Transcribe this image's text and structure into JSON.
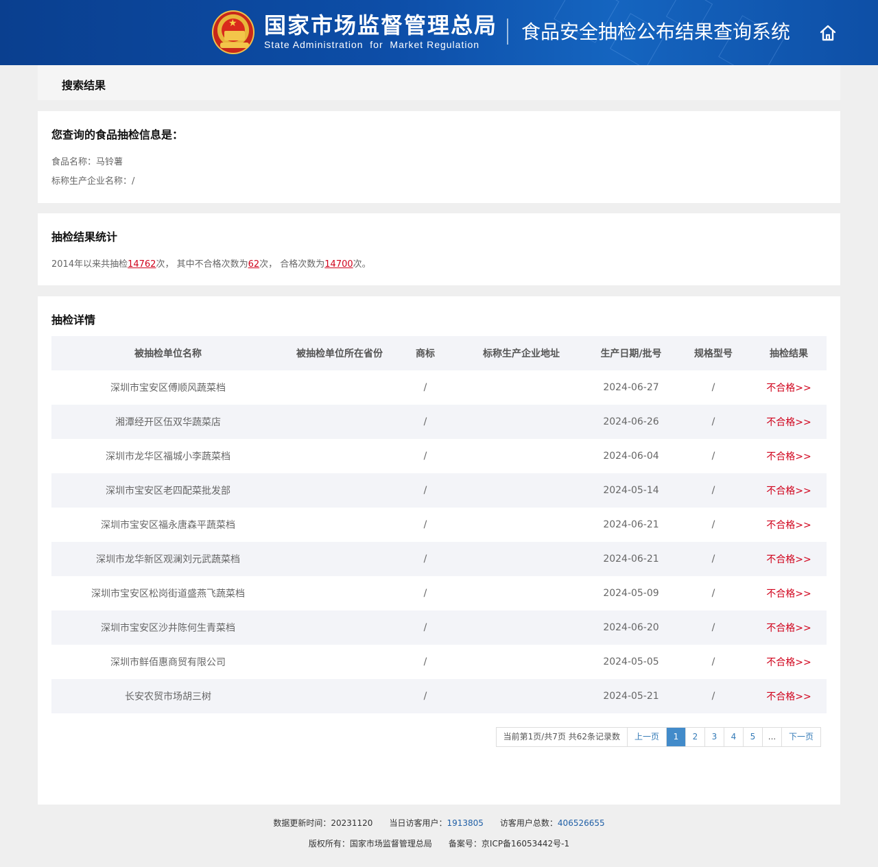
{
  "header": {
    "org_cn": "国家市场监督管理总局",
    "org_en": "State Administration  for  Market Regulation",
    "system_title": "食品安全抽检公布结果查询系统"
  },
  "breadcrumb": "搜索结果",
  "info": {
    "title": "您查询的食品抽检信息是：",
    "food_name": "食品名称：马铃薯",
    "manufacturer": "标称生产企业名称：/"
  },
  "stats": {
    "title": "抽检结果统计",
    "prefix": "2014年以来共抽检",
    "total": "14762",
    "mid1": "次， 其中不合格次数为",
    "fail": "62",
    "mid2": "次， 合格次数为",
    "pass": "14700",
    "suffix": "次。"
  },
  "detail": {
    "title": "抽检详情",
    "columns": [
      "被抽检单位名称",
      "被抽检单位所在省份",
      "商标",
      "标称生产企业地址",
      "生产日期/批号",
      "规格型号",
      "抽检结果"
    ],
    "rows": [
      {
        "unit": "深圳市宝安区傅顺风蔬菜档",
        "province": "",
        "brand": "/",
        "address": "",
        "date": "2024-06-27",
        "spec": "/",
        "result": "不合格>>"
      },
      {
        "unit": "湘潭经开区伍双华蔬菜店",
        "province": "",
        "brand": "/",
        "address": "",
        "date": "2024-06-26",
        "spec": "/",
        "result": "不合格>>"
      },
      {
        "unit": "深圳市龙华区福城小李蔬菜档",
        "province": "",
        "brand": "/",
        "address": "",
        "date": "2024-06-04",
        "spec": "/",
        "result": "不合格>>"
      },
      {
        "unit": "深圳市宝安区老四配菜批发部",
        "province": "",
        "brand": "/",
        "address": "",
        "date": "2024-05-14",
        "spec": "/",
        "result": "不合格>>"
      },
      {
        "unit": "深圳市宝安区福永唐森平蔬菜档",
        "province": "",
        "brand": "/",
        "address": "",
        "date": "2024-06-21",
        "spec": "/",
        "result": "不合格>>"
      },
      {
        "unit": "深圳市龙华新区观澜刘元武蔬菜档",
        "province": "",
        "brand": "/",
        "address": "",
        "date": "2024-06-21",
        "spec": "/",
        "result": "不合格>>"
      },
      {
        "unit": "深圳市宝安区松岗街道盛燕飞蔬菜档",
        "province": "",
        "brand": "/",
        "address": "",
        "date": "2024-05-09",
        "spec": "/",
        "result": "不合格>>"
      },
      {
        "unit": "深圳市宝安区沙井陈何生青菜档",
        "province": "",
        "brand": "/",
        "address": "",
        "date": "2024-06-20",
        "spec": "/",
        "result": "不合格>>"
      },
      {
        "unit": "深圳市鲜佰惠商贸有限公司",
        "province": "",
        "brand": "/",
        "address": "",
        "date": "2024-05-05",
        "spec": "/",
        "result": "不合格>>"
      },
      {
        "unit": "长安农贸市场胡三树",
        "province": "",
        "brand": "/",
        "address": "",
        "date": "2024-05-21",
        "spec": "/",
        "result": "不合格>>"
      }
    ]
  },
  "pagination": {
    "info": "当前第1页/共7页 共62条记录数",
    "prev": "上一页",
    "pages": [
      "1",
      "2",
      "3",
      "4",
      "5"
    ],
    "current": "1",
    "ellipsis": "...",
    "next": "下一页"
  },
  "footer": {
    "update_label": "数据更新时间：",
    "update_value": "20231120",
    "today_label": "当日访客用户：",
    "today_value": "1913805",
    "total_label": "访客用户总数：",
    "total_value": "406526655",
    "copyright": "版权所有：国家市场监督管理总局",
    "icp": "备案号：京ICP备16053442号-1"
  },
  "colors": {
    "header_blue": "#0d4ea8",
    "fail_red": "#d0021b",
    "link_blue": "#337ab7",
    "active_page": "#428bca"
  },
  "icons": [
    "national-emblem-icon",
    "home-icon"
  ]
}
